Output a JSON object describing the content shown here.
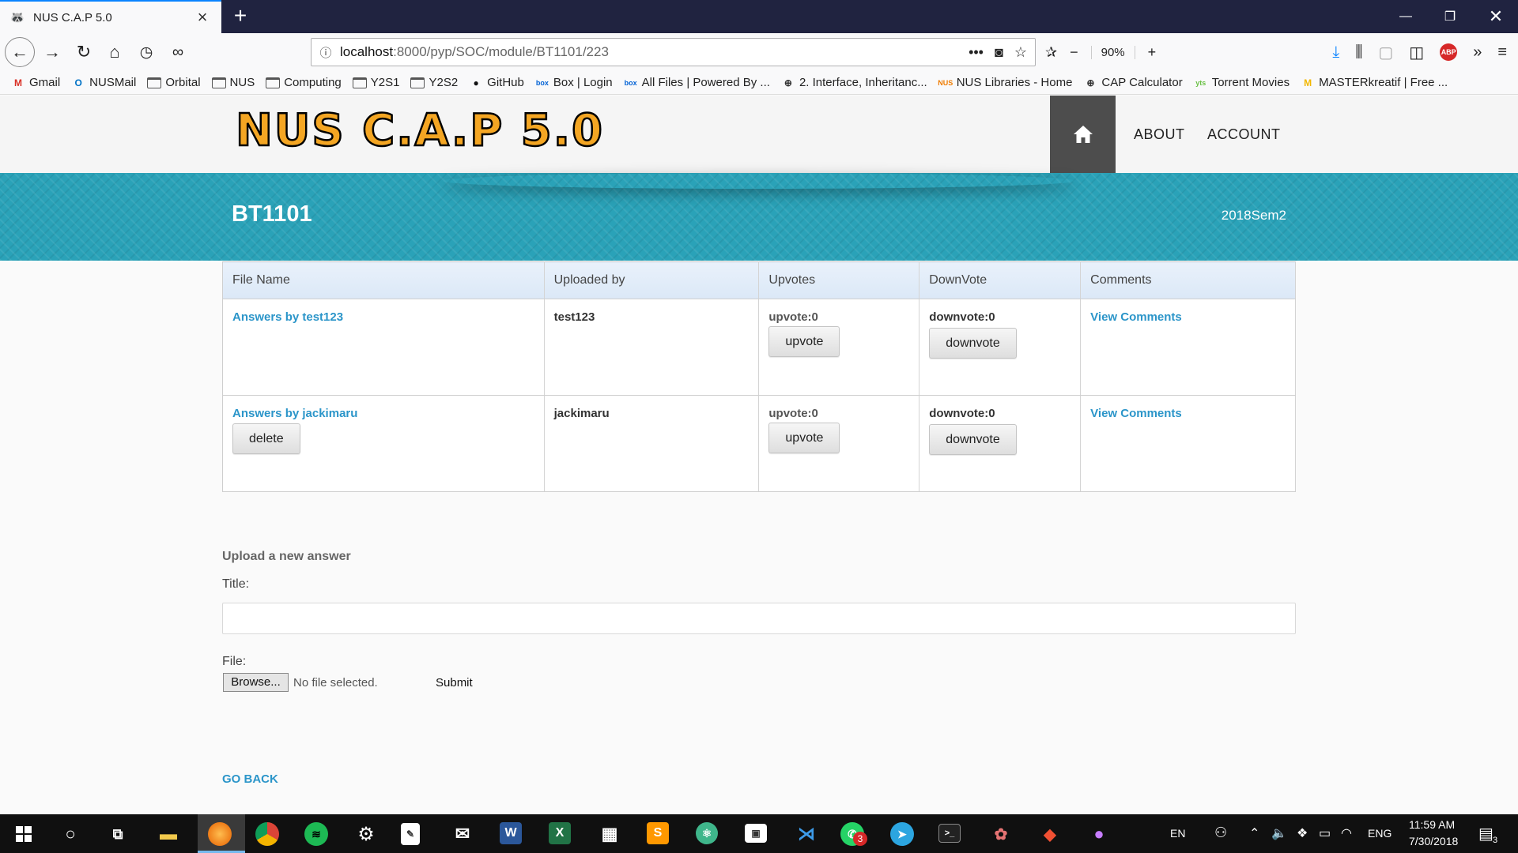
{
  "browser": {
    "tab_title": "NUS C.A.P 5.0",
    "url_host": "localhost",
    "url_path": ":8000/pyp/SOC/module/BT1101/223",
    "zoom": "90%",
    "bookmarks": [
      {
        "label": "Gmail",
        "icon": "gmail-icon",
        "glyph": "M",
        "color": "#d93025"
      },
      {
        "label": "NUSMail",
        "icon": "outlook-icon",
        "glyph": "O",
        "color": "#0072c6"
      },
      {
        "label": "Orbital",
        "icon": "folder-icon"
      },
      {
        "label": "NUS",
        "icon": "folder-icon"
      },
      {
        "label": "Computing",
        "icon": "folder-icon"
      },
      {
        "label": "Y2S1",
        "icon": "folder-icon"
      },
      {
        "label": "Y2S2",
        "icon": "folder-icon"
      },
      {
        "label": "GitHub",
        "icon": "github-icon",
        "glyph": "●",
        "color": "#111"
      },
      {
        "label": "Box | Login",
        "icon": "box-icon",
        "glyph": "box",
        "color": "#0061d5"
      },
      {
        "label": "All Files | Powered By ...",
        "icon": "box-icon",
        "glyph": "box",
        "color": "#0061d5"
      },
      {
        "label": "2. Interface, Inheritanc...",
        "icon": "globe-icon",
        "glyph": "⊕",
        "color": "#333"
      },
      {
        "label": "NUS Libraries - Home",
        "icon": "nus-libraries-icon",
        "glyph": "NUS",
        "color": "#ef7c00"
      },
      {
        "label": "CAP Calculator",
        "icon": "globe-icon",
        "glyph": "⊕",
        "color": "#333"
      },
      {
        "label": "Torrent Movies",
        "icon": "yts-icon",
        "glyph": "yts",
        "color": "#6ac045"
      },
      {
        "label": "MASTERkreatif | Free ...",
        "icon": "masterkreatif-icon",
        "glyph": "M",
        "color": "#f2b700"
      }
    ]
  },
  "site": {
    "logo_text": "NUS C.A.P 5.0",
    "nav": {
      "about": "ABOUT",
      "account": "ACCOUNT"
    },
    "module_code": "BT1101",
    "semester": "2018Sem2"
  },
  "table": {
    "headers": [
      "File Name",
      "Uploaded by",
      "Upvotes",
      "DownVote",
      "Comments"
    ],
    "rows": [
      {
        "file": "Answers by test123",
        "uploader": "test123",
        "upvotes": "upvote:0",
        "upvote_btn": "upvote",
        "downvotes": "downvote:0",
        "downvote_btn": "downvote",
        "comments": "View Comments",
        "delete_btn": ""
      },
      {
        "file": "Answers by jackimaru",
        "uploader": "jackimaru",
        "upvotes": "upvote:0",
        "upvote_btn": "upvote",
        "downvotes": "downvote:0",
        "downvote_btn": "downvote",
        "comments": "View Comments",
        "delete_btn": "delete"
      }
    ]
  },
  "upload": {
    "heading": "Upload a new answer",
    "title_label": "Title:",
    "title_value": "",
    "file_label": "File:",
    "browse_label": "Browse...",
    "no_file": "No file selected.",
    "submit_label": "Submit"
  },
  "go_back": "GO BACK",
  "taskbar": {
    "lang": "EN",
    "ime": "ENG",
    "time": "11:59 AM",
    "date": "7/30/2018",
    "notification_count": "3",
    "whatsapp_badge": "3"
  },
  "colors": {
    "banner": "#2aa2b8",
    "link": "#2b95c9",
    "logo_fill": "#f4a623",
    "home_button": "#4d4d4d"
  }
}
